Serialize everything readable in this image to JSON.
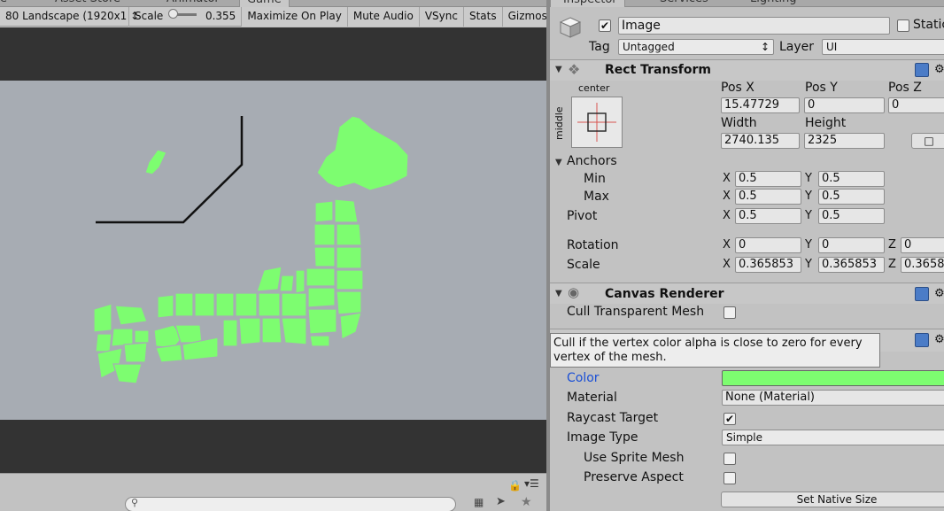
{
  "tabs": {
    "left_fragments": [
      "e",
      "Asset Store",
      "Animator",
      "Game"
    ],
    "right_fragments": [
      "Inspector",
      "Services",
      "Lighting"
    ]
  },
  "game_toolbar": {
    "resolution": "80 Landscape (1920x1 ↕",
    "scale_label": "Scale",
    "scale_value": "0.355",
    "maximize_on_play": "Maximize On Play",
    "mute_audio": "Mute Audio",
    "vsync": "VSync",
    "stats": "Stats",
    "gizmos": "Gizmos"
  },
  "colors": {
    "map_fill": "#7dfd70",
    "game_bg": "#a7acb3",
    "dark_band": "#333333",
    "color_swatch": "#7dfd70",
    "link_blue": "#1a4fd6"
  },
  "inspector": {
    "gameobject": {
      "active": true,
      "name": "Image",
      "static_label": "Static",
      "tag_label": "Tag",
      "tag_value": "Untagged",
      "layer_label": "Layer",
      "layer_value": "UI"
    },
    "rect_transform": {
      "title": "Rect Transform",
      "anchor_preset_h": "center",
      "anchor_preset_v": "middle",
      "pos_x_label": "Pos X",
      "pos_y_label": "Pos Y",
      "pos_z_label": "Pos Z",
      "pos_x": "15.47729",
      "pos_y": "0",
      "pos_z": "0",
      "width_label": "Width",
      "height_label": "Height",
      "width": "2740.135",
      "height": "2325",
      "anchors_label": "Anchors",
      "min_label": "Min",
      "max_label": "Max",
      "min_x": "0.5",
      "min_y": "0.5",
      "max_x": "0.5",
      "max_y": "0.5",
      "pivot_label": "Pivot",
      "pivot_x": "0.5",
      "pivot_y": "0.5",
      "rotation_label": "Rotation",
      "rot_x": "0",
      "rot_y": "0",
      "rot_z": "0",
      "scale_label": "Scale",
      "scale_x": "0.365853",
      "scale_y": "0.365853",
      "scale_z": "0.3658",
      "x": "X",
      "y": "Y",
      "z": "Z"
    },
    "canvas_renderer": {
      "title": "Canvas Renderer",
      "cull_label": "Cull Transparent Mesh",
      "cull_checked": false
    },
    "tooltip": "Cull if the vertex color alpha is close to zero for every vertex of the mesh.",
    "image": {
      "color_label": "Color",
      "material_label": "Material",
      "material_value": "None (Material)",
      "raycast_label": "Raycast Target",
      "raycast_checked": true,
      "image_type_label": "Image Type",
      "image_type_value": "Simple",
      "use_sprite_mesh_label": "Use Sprite Mesh",
      "preserve_aspect_label": "Preserve Aspect",
      "set_native_size": "Set Native Size"
    }
  },
  "icons": [
    "cube-icon",
    "checkmark-icon",
    "rect-transform-icon",
    "anchor-preset-icon",
    "help-icon",
    "settings-icon",
    "eye-icon",
    "lock-icon",
    "menu-icon",
    "search-icon",
    "layers-icon",
    "tag-icon",
    "star-icon"
  ]
}
